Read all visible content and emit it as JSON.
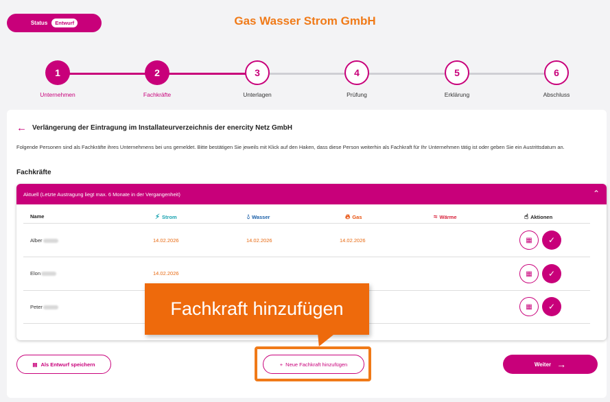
{
  "header": {
    "status_label": "Status",
    "status_value": "Entwurf",
    "company": "Gas Wasser Strom GmbH"
  },
  "stepper": {
    "steps": [
      {
        "number": "1",
        "label": "Unternehmen",
        "state": "done"
      },
      {
        "number": "2",
        "label": "Fachkräfte",
        "state": "done"
      },
      {
        "number": "3",
        "label": "Unterlagen",
        "state": "todo"
      },
      {
        "number": "4",
        "label": "Prüfung",
        "state": "todo"
      },
      {
        "number": "5",
        "label": "Erklärung",
        "state": "todo"
      },
      {
        "number": "6",
        "label": "Abschluss",
        "state": "todo"
      }
    ]
  },
  "main": {
    "back_icon": "arrow-left-icon",
    "title": "Verlängerung der Eintragung im Installateurverzeichnis der enercity Netz GmbH",
    "intro": "Folgende Personen sind als Fachkräfte ihres Unternehmens bei uns gemeldet. Bitte bestätigen Sie jeweils mit Klick auf den Haken, dass diese Person weiterhin als Fachkraft für Ihr Unternehmen tätig ist oder geben Sie ein Austrittsdatum an.",
    "section_title": "Fachkräfte"
  },
  "panel": {
    "header": "Aktuell (Letzte Austragung liegt max. 6 Monate in der Vergangenheit)",
    "columns": {
      "name": "Name",
      "strom": "Strom",
      "wasser": "Wasser",
      "gas": "Gas",
      "waerme": "Wärme",
      "aktionen": "Aktionen"
    },
    "rows": [
      {
        "name": "Alber",
        "strom": "14.02.2026",
        "wasser": "14.02.2026",
        "gas": "14.02.2026"
      },
      {
        "name": "Elon",
        "strom": "14.02.2026",
        "wasser": "",
        "gas": ""
      },
      {
        "name": "Peter",
        "strom": "",
        "wasser": "",
        "gas": ""
      }
    ]
  },
  "buttons": {
    "draft": "Als Entwurf speichern",
    "add": "Neue Fachkraft hinzufügen",
    "next": "Weiter"
  },
  "tooltip": {
    "text": "Fachkraft hinzufügen"
  },
  "colors": {
    "primary": "#c8007a",
    "accent": "#f07a18",
    "date": "#e8680f",
    "strom": "#1aa3b0",
    "wasser": "#1a5fa8",
    "gas": "#e8520f",
    "waerme": "#d8203a"
  }
}
